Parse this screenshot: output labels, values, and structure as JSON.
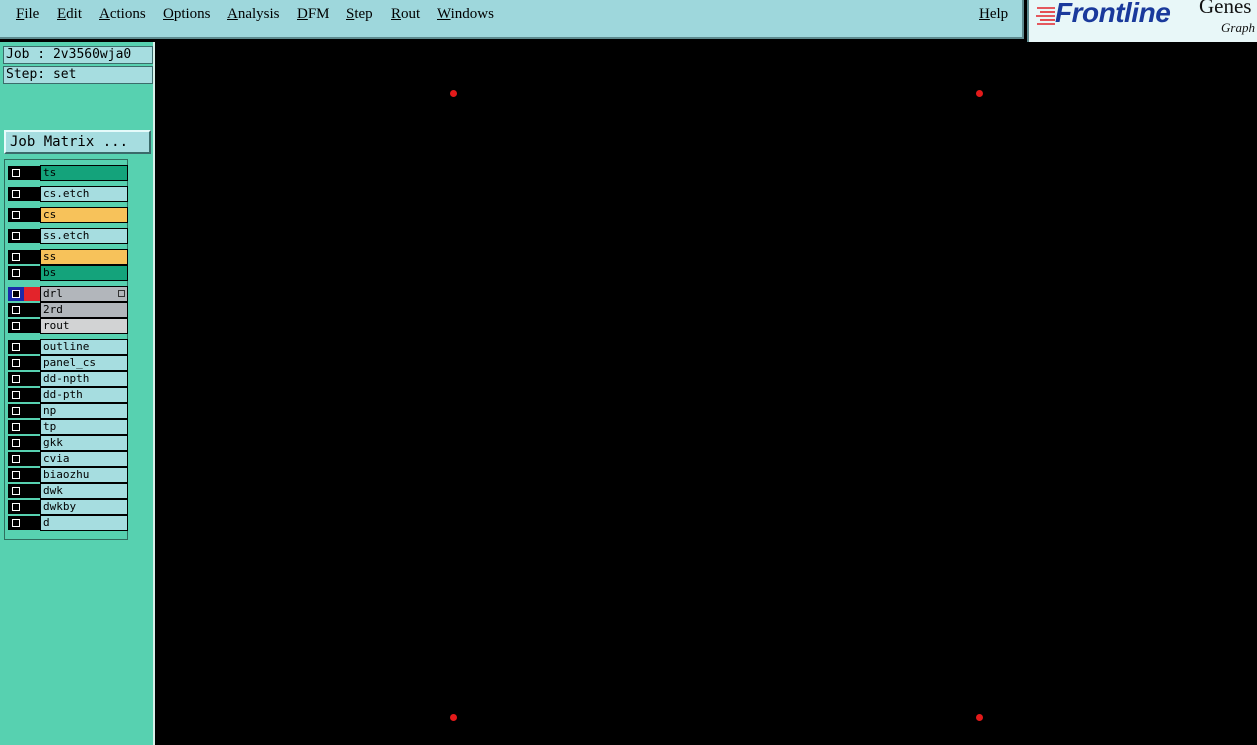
{
  "menubar": {
    "items": [
      {
        "label": "File"
      },
      {
        "label": "Edit"
      },
      {
        "label": "Actions"
      },
      {
        "label": "Options"
      },
      {
        "label": "Analysis"
      },
      {
        "label": "DFM"
      },
      {
        "label": "Step"
      },
      {
        "label": "Rout"
      },
      {
        "label": "Windows"
      }
    ],
    "help": "Help"
  },
  "logo": {
    "brand": "Frontline",
    "product": "Genes",
    "subtitle": "Graph",
    "brand_color": "#1a3a9c",
    "accent_color": "#e3242b"
  },
  "job": {
    "job_label": "Job : 2v3560wja0",
    "step_label": "Step: set",
    "matrix_button": "Job Matrix ..."
  },
  "layers": [
    {
      "name": "ts",
      "color": "#14a37b"
    },
    {
      "name": "cs.etch",
      "color": "#a6dde0"
    },
    {
      "name": "cs",
      "color": "#f7c25a"
    },
    {
      "name": "ss.etch",
      "color": "#a6dde0"
    },
    {
      "name": "ss",
      "color": "#f7c25a"
    },
    {
      "name": "bs",
      "color": "#14a37b"
    },
    {
      "name": "drl",
      "color": "#b2b6bb",
      "active": true
    },
    {
      "name": "2rd",
      "color": "#b2b6bb"
    },
    {
      "name": "rout",
      "color": "#d2d3d4"
    },
    {
      "name": "outline",
      "color": "#a6dde0"
    },
    {
      "name": "panel_cs",
      "color": "#a6dde0"
    },
    {
      "name": "dd-npth",
      "color": "#a6dde0"
    },
    {
      "name": "dd-pth",
      "color": "#a6dde0"
    },
    {
      "name": "np",
      "color": "#a6dde0"
    },
    {
      "name": "tp",
      "color": "#a6dde0"
    },
    {
      "name": "gkk",
      "color": "#a6dde0"
    },
    {
      "name": "cvia",
      "color": "#a6dde0"
    },
    {
      "name": "biaozhu",
      "color": "#a6dde0"
    },
    {
      "name": "dwk",
      "color": "#a6dde0"
    },
    {
      "name": "dwkby",
      "color": "#a6dde0"
    },
    {
      "name": "d",
      "color": "#a6dde0"
    }
  ],
  "canvas": {
    "background": "#000000",
    "fiducial_color": "#e31a1a"
  }
}
